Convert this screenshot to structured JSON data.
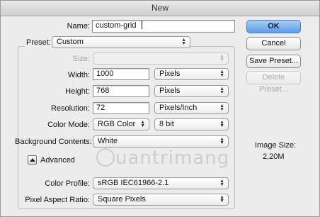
{
  "window": {
    "title": "New"
  },
  "name": {
    "label": "Name:",
    "value": "custom-grid"
  },
  "preset": {
    "label": "Preset:",
    "value": "Custom"
  },
  "size": {
    "label": "Size:",
    "value": ""
  },
  "width": {
    "label": "Width:",
    "value": "1000",
    "unit": "Pixels"
  },
  "height": {
    "label": "Height:",
    "value": "768",
    "unit": "Pixels"
  },
  "resolution": {
    "label": "Resolution:",
    "value": "72",
    "unit": "Pixels/Inch"
  },
  "color_mode": {
    "label": "Color Mode:",
    "value": "RGB Color",
    "depth": "8 bit"
  },
  "background": {
    "label": "Background Contents:",
    "value": "White"
  },
  "advanced": {
    "label": "Advanced"
  },
  "color_profile": {
    "label": "Color Profile:",
    "value": "sRGB IEC61966-2.1"
  },
  "pixel_aspect": {
    "label": "Pixel Aspect Ratio:",
    "value": "Square Pixels"
  },
  "buttons": {
    "ok": "OK",
    "cancel": "Cancel",
    "save_preset": "Save Preset...",
    "delete_preset": "Delete Preset..."
  },
  "image_size": {
    "label": "Image Size:",
    "value": "2,20M"
  },
  "watermark": {
    "text": "uantrimang"
  },
  "colors": {
    "default_button": "#5b9de2",
    "background": "#ececec"
  }
}
